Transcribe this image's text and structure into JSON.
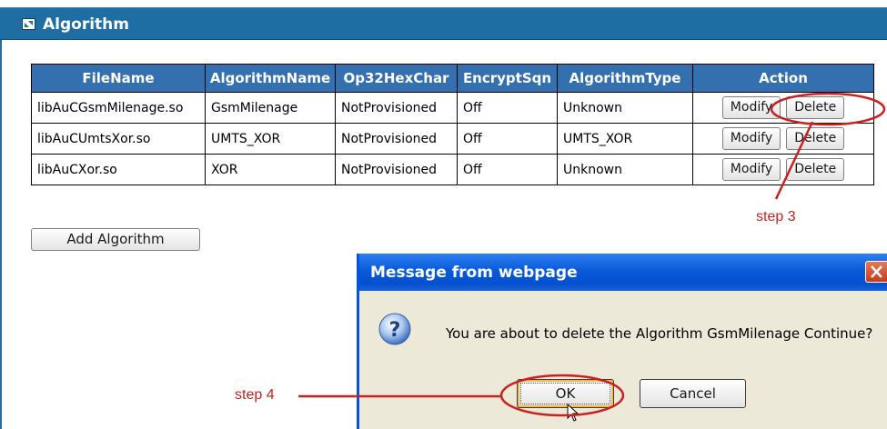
{
  "panel": {
    "title": "Algorithm"
  },
  "table": {
    "headers": [
      "FileName",
      "AlgorithmName",
      "Op32HexChar",
      "EncryptSqn",
      "AlgorithmType",
      "Action"
    ],
    "rows": [
      {
        "file_name": "libAuCGsmMilenage.so",
        "algorithm_name": "GsmMilenage",
        "op32hexchar": "NotProvisioned",
        "encrypt_sqn": "Off",
        "algorithm_type": "Unknown",
        "modify_label": "Modify",
        "delete_label": "Delete"
      },
      {
        "file_name": "libAuCUmtsXor.so",
        "algorithm_name": "UMTS_XOR",
        "op32hexchar": "NotProvisioned",
        "encrypt_sqn": "Off",
        "algorithm_type": "UMTS_XOR",
        "modify_label": "Modify",
        "delete_label": "Delete"
      },
      {
        "file_name": "libAuCXor.so",
        "algorithm_name": "XOR",
        "op32hexchar": "NotProvisioned",
        "encrypt_sqn": "Off",
        "algorithm_type": "Unknown",
        "modify_label": "Modify",
        "delete_label": "Delete"
      }
    ]
  },
  "add_button": {
    "label": "Add Algorithm"
  },
  "annotations": {
    "step3": "step 3",
    "step4": "step 4",
    "color": "#cc1f1f"
  },
  "dialog": {
    "title": "Message from webpage",
    "message": "You are about to delete the Algorithm GsmMilenage Continue?",
    "ok_label": "OK",
    "cancel_label": "Cancel",
    "icon": "question-icon"
  },
  "colors": {
    "header_bar": "#1f6ea3",
    "table_header": "#346fb0",
    "dialog_titlebar": "#0a5ad8"
  }
}
